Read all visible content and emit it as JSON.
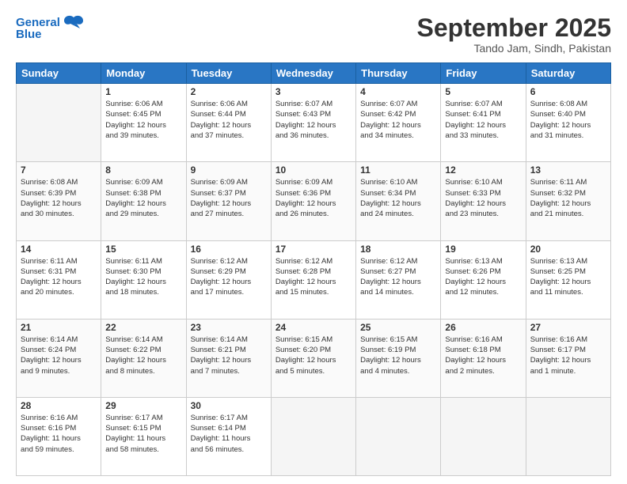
{
  "logo": {
    "line1": "General",
    "line2": "Blue"
  },
  "header": {
    "title": "September 2025",
    "subtitle": "Tando Jam, Sindh, Pakistan"
  },
  "days": [
    "Sunday",
    "Monday",
    "Tuesday",
    "Wednesday",
    "Thursday",
    "Friday",
    "Saturday"
  ],
  "weeks": [
    [
      {
        "num": "",
        "info": ""
      },
      {
        "num": "1",
        "info": "Sunrise: 6:06 AM\nSunset: 6:45 PM\nDaylight: 12 hours\nand 39 minutes."
      },
      {
        "num": "2",
        "info": "Sunrise: 6:06 AM\nSunset: 6:44 PM\nDaylight: 12 hours\nand 37 minutes."
      },
      {
        "num": "3",
        "info": "Sunrise: 6:07 AM\nSunset: 6:43 PM\nDaylight: 12 hours\nand 36 minutes."
      },
      {
        "num": "4",
        "info": "Sunrise: 6:07 AM\nSunset: 6:42 PM\nDaylight: 12 hours\nand 34 minutes."
      },
      {
        "num": "5",
        "info": "Sunrise: 6:07 AM\nSunset: 6:41 PM\nDaylight: 12 hours\nand 33 minutes."
      },
      {
        "num": "6",
        "info": "Sunrise: 6:08 AM\nSunset: 6:40 PM\nDaylight: 12 hours\nand 31 minutes."
      }
    ],
    [
      {
        "num": "7",
        "info": "Sunrise: 6:08 AM\nSunset: 6:39 PM\nDaylight: 12 hours\nand 30 minutes."
      },
      {
        "num": "8",
        "info": "Sunrise: 6:09 AM\nSunset: 6:38 PM\nDaylight: 12 hours\nand 29 minutes."
      },
      {
        "num": "9",
        "info": "Sunrise: 6:09 AM\nSunset: 6:37 PM\nDaylight: 12 hours\nand 27 minutes."
      },
      {
        "num": "10",
        "info": "Sunrise: 6:09 AM\nSunset: 6:36 PM\nDaylight: 12 hours\nand 26 minutes."
      },
      {
        "num": "11",
        "info": "Sunrise: 6:10 AM\nSunset: 6:34 PM\nDaylight: 12 hours\nand 24 minutes."
      },
      {
        "num": "12",
        "info": "Sunrise: 6:10 AM\nSunset: 6:33 PM\nDaylight: 12 hours\nand 23 minutes."
      },
      {
        "num": "13",
        "info": "Sunrise: 6:11 AM\nSunset: 6:32 PM\nDaylight: 12 hours\nand 21 minutes."
      }
    ],
    [
      {
        "num": "14",
        "info": "Sunrise: 6:11 AM\nSunset: 6:31 PM\nDaylight: 12 hours\nand 20 minutes."
      },
      {
        "num": "15",
        "info": "Sunrise: 6:11 AM\nSunset: 6:30 PM\nDaylight: 12 hours\nand 18 minutes."
      },
      {
        "num": "16",
        "info": "Sunrise: 6:12 AM\nSunset: 6:29 PM\nDaylight: 12 hours\nand 17 minutes."
      },
      {
        "num": "17",
        "info": "Sunrise: 6:12 AM\nSunset: 6:28 PM\nDaylight: 12 hours\nand 15 minutes."
      },
      {
        "num": "18",
        "info": "Sunrise: 6:12 AM\nSunset: 6:27 PM\nDaylight: 12 hours\nand 14 minutes."
      },
      {
        "num": "19",
        "info": "Sunrise: 6:13 AM\nSunset: 6:26 PM\nDaylight: 12 hours\nand 12 minutes."
      },
      {
        "num": "20",
        "info": "Sunrise: 6:13 AM\nSunset: 6:25 PM\nDaylight: 12 hours\nand 11 minutes."
      }
    ],
    [
      {
        "num": "21",
        "info": "Sunrise: 6:14 AM\nSunset: 6:24 PM\nDaylight: 12 hours\nand 9 minutes."
      },
      {
        "num": "22",
        "info": "Sunrise: 6:14 AM\nSunset: 6:22 PM\nDaylight: 12 hours\nand 8 minutes."
      },
      {
        "num": "23",
        "info": "Sunrise: 6:14 AM\nSunset: 6:21 PM\nDaylight: 12 hours\nand 7 minutes."
      },
      {
        "num": "24",
        "info": "Sunrise: 6:15 AM\nSunset: 6:20 PM\nDaylight: 12 hours\nand 5 minutes."
      },
      {
        "num": "25",
        "info": "Sunrise: 6:15 AM\nSunset: 6:19 PM\nDaylight: 12 hours\nand 4 minutes."
      },
      {
        "num": "26",
        "info": "Sunrise: 6:16 AM\nSunset: 6:18 PM\nDaylight: 12 hours\nand 2 minutes."
      },
      {
        "num": "27",
        "info": "Sunrise: 6:16 AM\nSunset: 6:17 PM\nDaylight: 12 hours\nand 1 minute."
      }
    ],
    [
      {
        "num": "28",
        "info": "Sunrise: 6:16 AM\nSunset: 6:16 PM\nDaylight: 11 hours\nand 59 minutes."
      },
      {
        "num": "29",
        "info": "Sunrise: 6:17 AM\nSunset: 6:15 PM\nDaylight: 11 hours\nand 58 minutes."
      },
      {
        "num": "30",
        "info": "Sunrise: 6:17 AM\nSunset: 6:14 PM\nDaylight: 11 hours\nand 56 minutes."
      },
      {
        "num": "",
        "info": ""
      },
      {
        "num": "",
        "info": ""
      },
      {
        "num": "",
        "info": ""
      },
      {
        "num": "",
        "info": ""
      }
    ]
  ]
}
